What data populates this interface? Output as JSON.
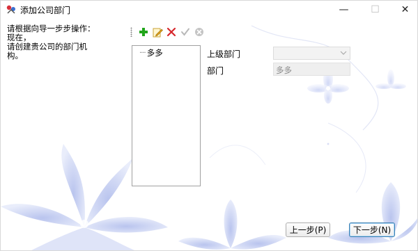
{
  "window": {
    "title": "添加公司部门",
    "minimize_symbol": "—",
    "maximize_symbol": "☐",
    "close_symbol": "✕"
  },
  "instruction": {
    "line1": "请根据向导一步步操作：",
    "line2": "现在，",
    "line3": "请创建贵公司的部门机构。"
  },
  "toolbar": {
    "icons": [
      "add-icon",
      "edit-icon",
      "delete-icon",
      "confirm-icon",
      "cancel-icon"
    ],
    "colors": {
      "add": "#21a51b",
      "edit": "#e0a21a",
      "delete": "#d6262b",
      "disabled": "#b8b8b8"
    }
  },
  "tree": {
    "nodes": [
      {
        "label": "多多"
      }
    ]
  },
  "form": {
    "parent_dept_label": "上级部门",
    "parent_dept_value": "",
    "dept_label": "部门",
    "dept_value": "多多"
  },
  "buttons": {
    "prev": "上一步(P)",
    "next": "下一步(N)"
  }
}
